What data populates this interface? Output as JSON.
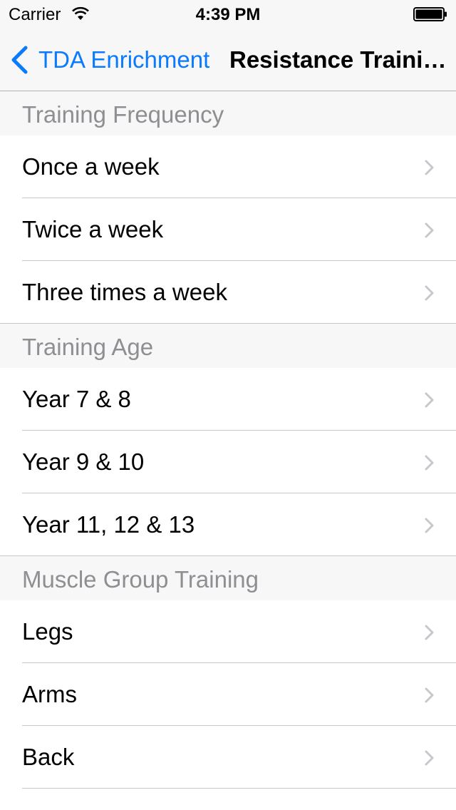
{
  "status_bar": {
    "carrier": "Carrier",
    "time": "4:39 PM"
  },
  "nav": {
    "back_label": "TDA Enrichment",
    "title": "Resistance Traini…"
  },
  "sections": [
    {
      "title": "Training Frequency",
      "items": [
        "Once a week",
        "Twice a week",
        "Three times a week"
      ]
    },
    {
      "title": "Training Age",
      "items": [
        "Year 7 & 8",
        "Year 9 & 10",
        "Year 11, 12 & 13"
      ]
    },
    {
      "title": "Muscle Group Training",
      "items": [
        "Legs",
        "Arms",
        "Back"
      ]
    }
  ],
  "colors": {
    "accent": "#0a7aff",
    "header_text": "#8e8e93",
    "chevron": "#c7c7cc"
  }
}
